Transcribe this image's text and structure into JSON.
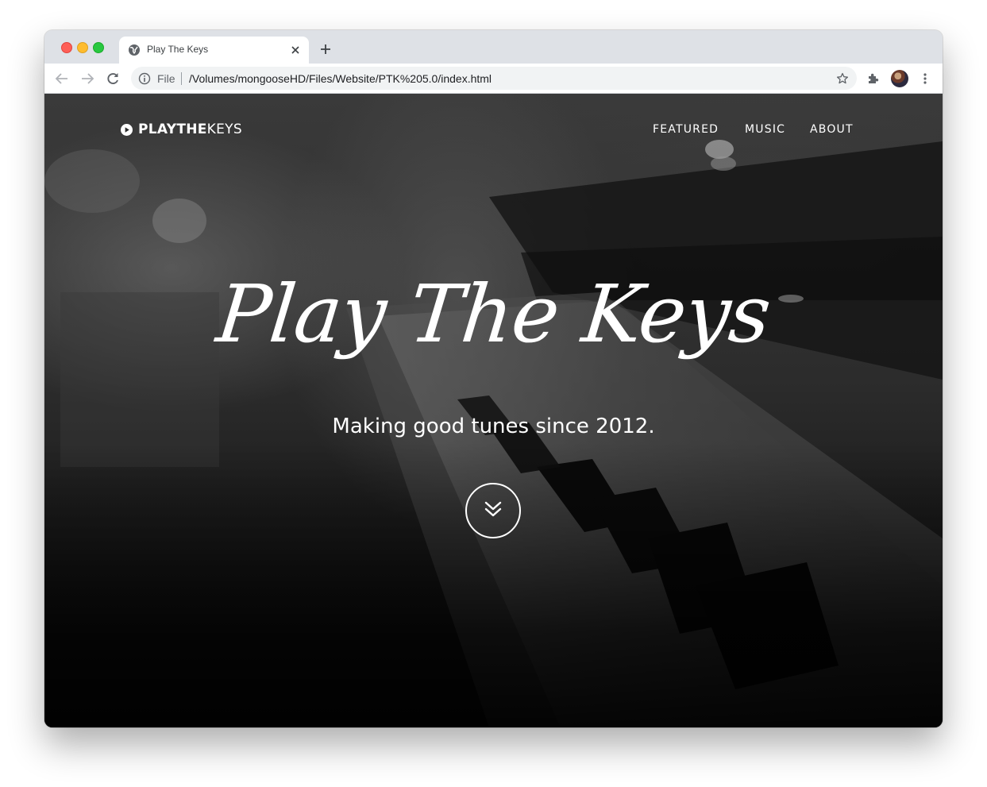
{
  "browser": {
    "tab_title": "Play The Keys",
    "url_scheme": "File",
    "url": "/Volumes/mongooseHD/Files/Website/PTK%205.0/index.html"
  },
  "site": {
    "brand_bold": "PLAYTHE",
    "brand_light": "KEYS",
    "nav": [
      "FEATURED",
      "MUSIC",
      "ABOUT"
    ],
    "hero_title": "Play The Keys",
    "hero_subtitle": "Making good tunes since 2012."
  },
  "colors": {
    "accent": "#ffffff",
    "tabstrip": "#dee1e6",
    "omnibox": "#f1f3f4"
  },
  "icons": {
    "favicon": "globe-icon",
    "tab_close": "close-icon",
    "new_tab": "plus-icon",
    "back": "back-arrow-icon",
    "forward": "forward-arrow-icon",
    "reload": "reload-icon",
    "site_info": "info-icon",
    "bookmark": "star-icon",
    "extensions": "puzzle-icon",
    "menu": "kebab-menu-icon",
    "brand": "play-circle-icon",
    "scroll": "double-chevron-down-icon"
  }
}
